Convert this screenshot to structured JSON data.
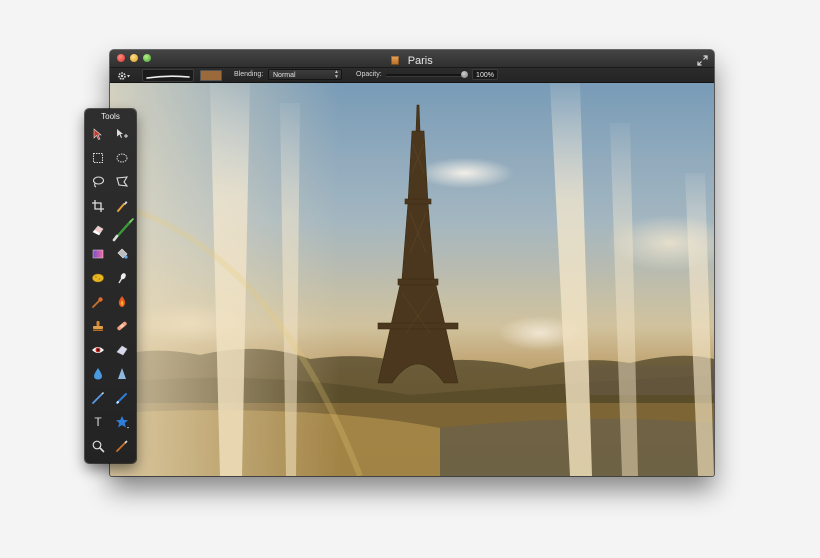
{
  "window": {
    "title": "Paris"
  },
  "toolbar": {
    "blending_label": "Blending:",
    "blending_value": "Normal",
    "opacity_label": "Opacity:",
    "opacity_value": "100%",
    "opacity_level": 1.0,
    "brush_color": "#9a6a3a"
  },
  "tools_panel": {
    "title": "Tools",
    "type_tool_glyph": "T",
    "tools": [
      "move-icon",
      "selection-move-icon",
      "rect-marquee-icon",
      "ellipse-marquee-icon",
      "lasso-icon",
      "polygon-lasso-icon",
      "crop-icon",
      "eyedropper-icon",
      "eraser-icon",
      "brush-icon",
      "gradient-icon",
      "paint-bucket-icon",
      "sponge-icon",
      "smudge-icon",
      "burn-icon",
      "dodge-icon",
      "clone-stamp-icon",
      "bandage-icon",
      "red-eye-icon",
      "sharpen-eraser-icon",
      "blur-drop-icon",
      "sharpen-cone-icon",
      "pen-icon",
      "pencil-icon",
      "type-icon",
      "shape-star-icon",
      "zoom-icon",
      "color-picker-brush-icon"
    ]
  },
  "colors": {
    "window_bg": "#2a2a2a",
    "accent_blue": "#2f7ed8"
  }
}
